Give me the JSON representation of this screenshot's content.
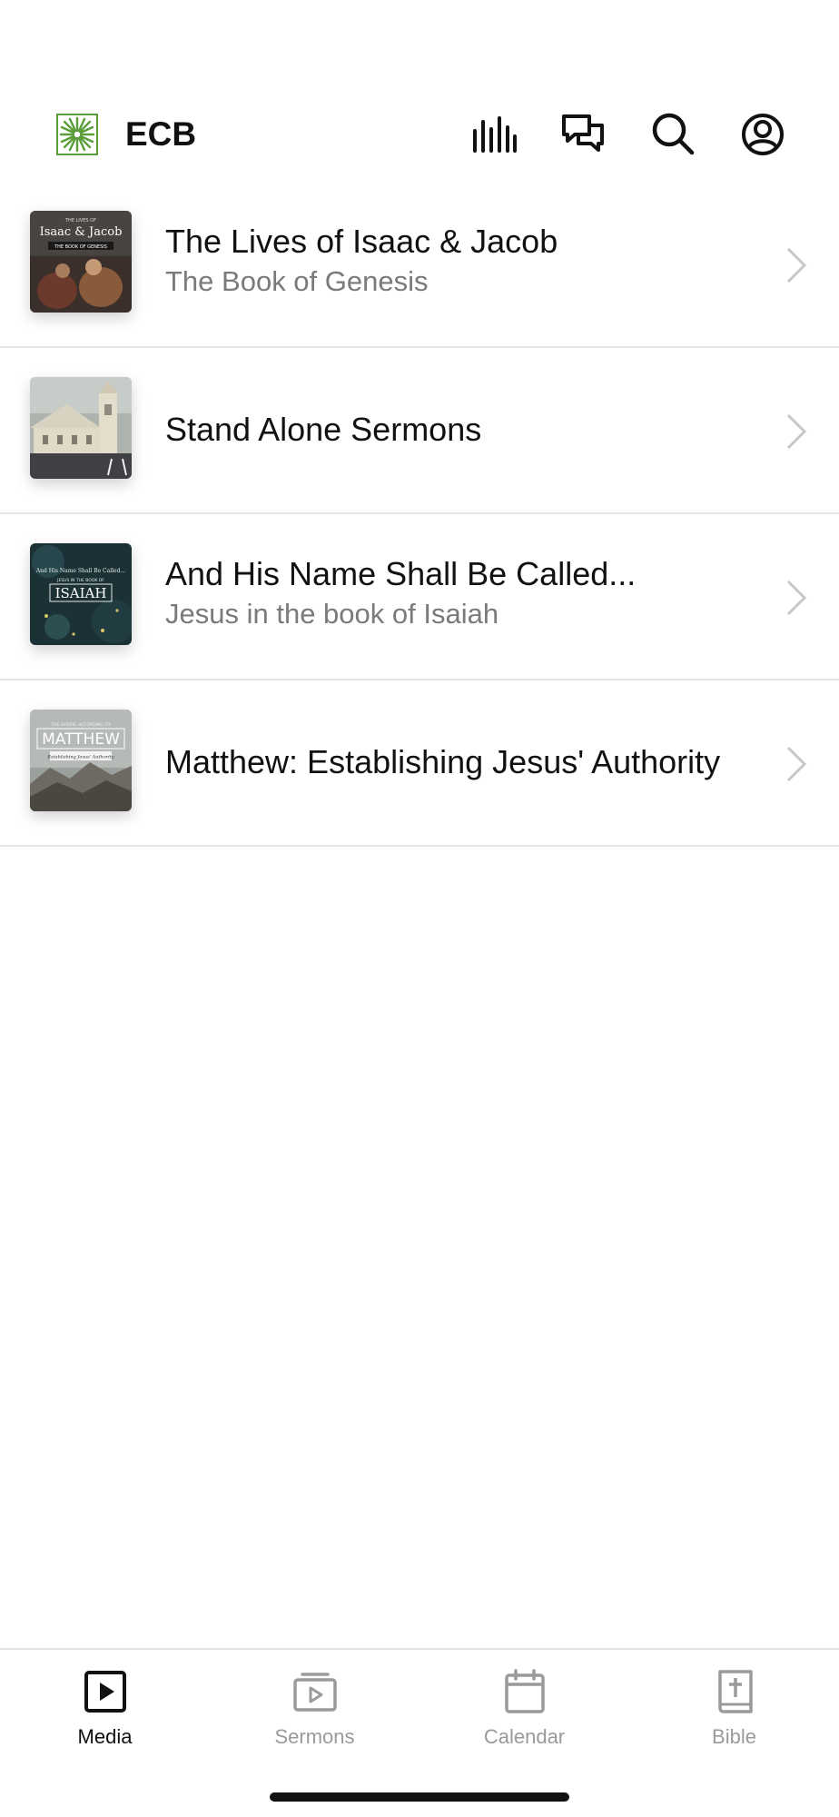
{
  "header": {
    "app_title": "ECB",
    "logo_icon": "sunburst-logo-icon",
    "actions": [
      "audio-bars-icon",
      "chat-icon",
      "search-icon",
      "account-icon"
    ],
    "brand_color": "#5a9e3a"
  },
  "series": [
    {
      "title": "The Lives of Isaac & Jacob",
      "subtitle": "The Book of Genesis",
      "thumb": {
        "small": "THE LIVES OF",
        "main": "Isaac & Jacob",
        "band": "THE BOOK OF GENESIS"
      }
    },
    {
      "title": "Stand Alone Sermons",
      "subtitle": "",
      "thumb": {}
    },
    {
      "title": "And His Name Shall Be Called...",
      "subtitle": "Jesus in the book of Isaiah",
      "thumb": {
        "small": "And His Name Shall Be Called...",
        "band": "JESUS IN THE BOOK OF",
        "main": "ISAIAH"
      }
    },
    {
      "title": "Matthew: Establishing Jesus' Authority",
      "subtitle": "",
      "thumb": {
        "small": "THE GOSPEL ACCORDING TO",
        "main": "MATTHEW",
        "band": "Establishing Jesus' Authority"
      }
    }
  ],
  "tabs": [
    {
      "label": "Media",
      "icon": "play-square-icon",
      "active": true
    },
    {
      "label": "Sermons",
      "icon": "video-stack-icon",
      "active": false
    },
    {
      "label": "Calendar",
      "icon": "calendar-icon",
      "active": false
    },
    {
      "label": "Bible",
      "icon": "bible-icon",
      "active": false
    }
  ],
  "colors": {
    "active_tab": "#111111",
    "inactive_tab": "#9a9a9a",
    "subtitle": "#7a7a7a"
  }
}
